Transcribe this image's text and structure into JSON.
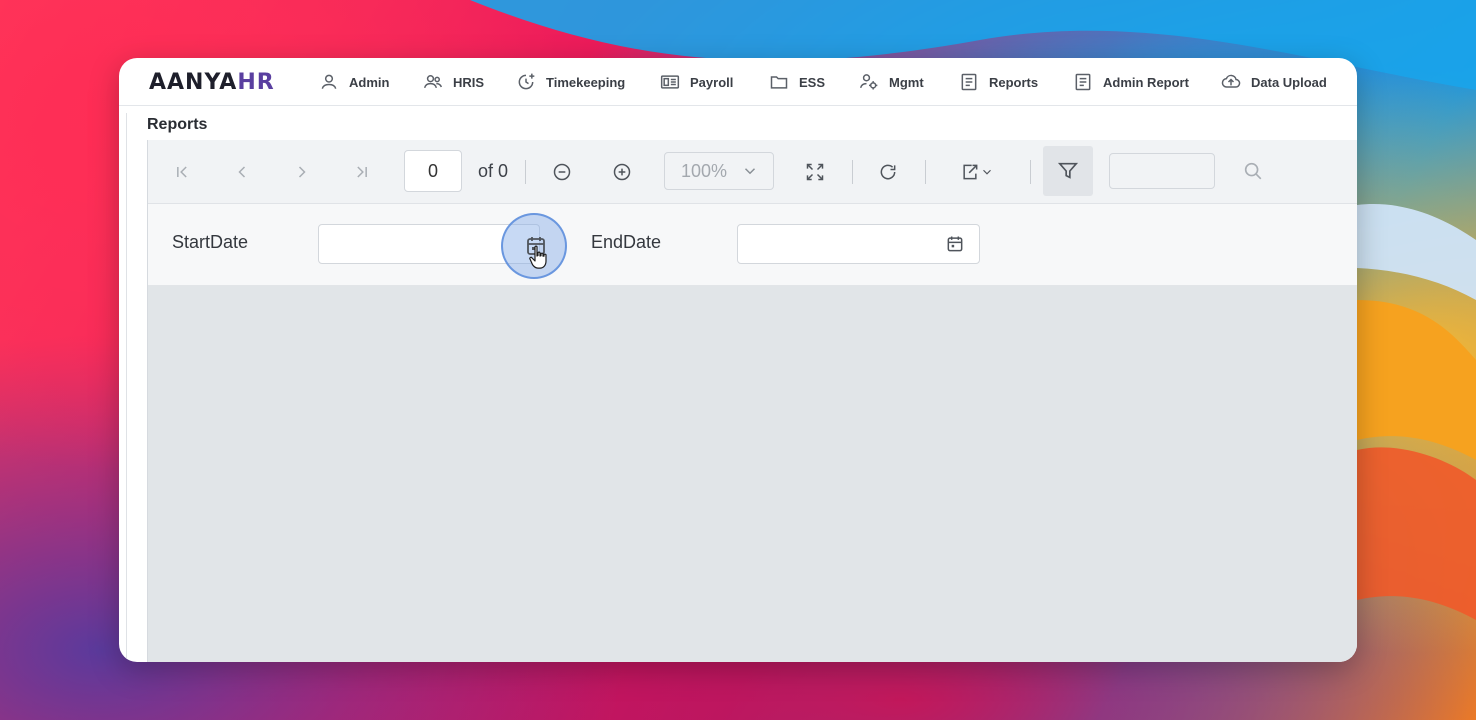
{
  "logo": {
    "main": "AANYA",
    "accent": "HR"
  },
  "nav": [
    {
      "label": "Admin",
      "icon": "person-icon"
    },
    {
      "label": "HRIS",
      "icon": "people-icon"
    },
    {
      "label": "Timekeeping",
      "icon": "clock-plus-icon"
    },
    {
      "label": "Payroll",
      "icon": "payroll-icon"
    },
    {
      "label": "ESS",
      "icon": "folder-icon"
    },
    {
      "label": "Mgmt",
      "icon": "person-gear-icon"
    },
    {
      "label": "Reports",
      "icon": "document-icon"
    },
    {
      "label": "Admin Report",
      "icon": "document-icon"
    },
    {
      "label": "Data Upload",
      "icon": "cloud-upload-icon"
    }
  ],
  "page": {
    "title": "Reports"
  },
  "toolbar": {
    "page_value": "0",
    "of_label": "of 0",
    "zoom_value": "100%",
    "search_value": ""
  },
  "params": {
    "start_label": "StartDate",
    "start_value": "",
    "end_label": "EndDate",
    "end_value": ""
  },
  "colors": {
    "accent": "#5a3fa0",
    "viewer_bg": "#e1e5e8",
    "click_highlight": "#82aae6"
  }
}
